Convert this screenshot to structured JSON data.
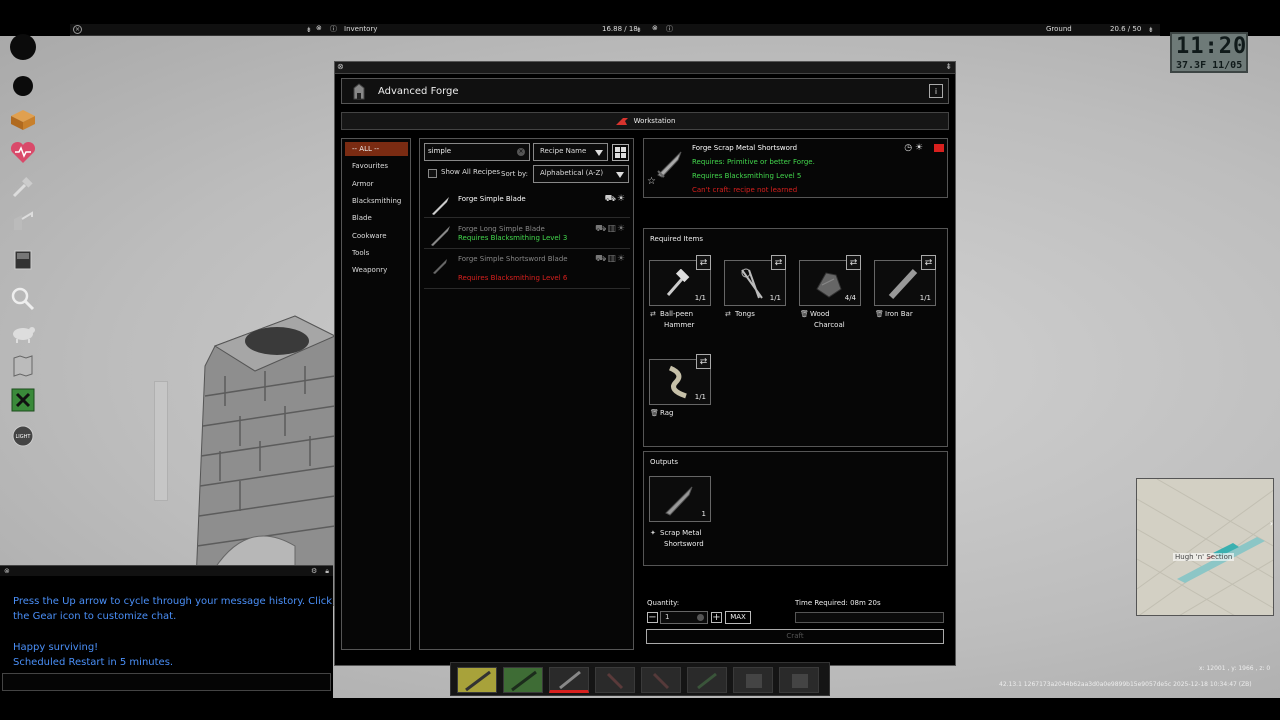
{
  "topbar": {
    "inventory_label": "Inventory",
    "inventory_weight": "16.88 / 18",
    "ground_label": "Ground",
    "ground_weight": "20.6 / 50"
  },
  "clock": {
    "time": "11:20",
    "date": "37.3F 11/05"
  },
  "left_icons": [
    "status-circle-icon",
    "status-circle-icon",
    "inventory-box-icon",
    "health-heart-icon",
    "crafting-hammer-icon",
    "building-icon",
    "furniture-icon",
    "search-magnifier-icon",
    "animal-icon",
    "map-icon",
    "craft-menu-icon",
    "light-icon"
  ],
  "chat": {
    "lines": [
      "Press the Up arrow to cycle through your message history. Click",
      "the Gear icon to customize chat.",
      "Happy surviving!",
      "Scheduled Restart in 5 minutes."
    ]
  },
  "forge": {
    "title": "Advanced Forge",
    "info": "i",
    "workstation": "Workstation",
    "categories": [
      "-- ALL --",
      "Favourites",
      "Armor",
      "Blacksmithing",
      "Blade",
      "Cookware",
      "Tools",
      "Weaponry"
    ],
    "search_value": "simple",
    "sort_field": "Recipe Name",
    "show_all_label": "Show All Recipes",
    "sort_by_label": "Sort by:",
    "sort_order": "Alphabetical (A-Z)",
    "recipes": [
      {
        "name": "Forge Simple Blade",
        "req": "",
        "status": "ok"
      },
      {
        "name": "Forge Long Simple Blade",
        "req": "Requires Blacksmithing Level 3",
        "status": "green"
      },
      {
        "name": "Forge Simple Shortsword Blade",
        "req": "Requires Blacksmithing Level 6",
        "status": "red"
      }
    ],
    "selected": {
      "name": "Forge Scrap Metal Shortsword",
      "req1": "Requires: Primitive or better Forge.",
      "req2": "Requires Blacksmithing Level 5",
      "req3": "Can't craft: recipe not learned"
    },
    "required_title": "Required Items",
    "required_items": [
      {
        "label1": "Ball-peen",
        "label2": "Hammer",
        "count": "1/1",
        "mode": "⇄"
      },
      {
        "label1": "Tongs",
        "label2": "",
        "count": "1/1",
        "mode": "⇄"
      },
      {
        "label1": "Wood",
        "label2": "Charcoal",
        "count": "4/4",
        "mode": "🗑"
      },
      {
        "label1": "Iron Bar",
        "label2": "",
        "count": "1/1",
        "mode": "🗑"
      },
      {
        "label1": "Rag",
        "label2": "",
        "count": "1/1",
        "mode": "🗑"
      }
    ],
    "outputs_title": "Outputs",
    "output": {
      "label1": "Scrap Metal",
      "label2": "Shortsword",
      "count": "1"
    },
    "quantity_label": "Quantity:",
    "quantity_value": "1",
    "max_label": "MAX",
    "time_label": "Time Required: 08m 20s",
    "craft_label": "Craft"
  },
  "minimap": {
    "label": "Hugh 'n' Section"
  },
  "coords": "x: 12001 , y: 1966 , z: 0",
  "build": "42.13.1 1267173a2044b62aa3d0a0e9899b15e9057de5c 2025-12-18 10:34:47 (ZB)"
}
